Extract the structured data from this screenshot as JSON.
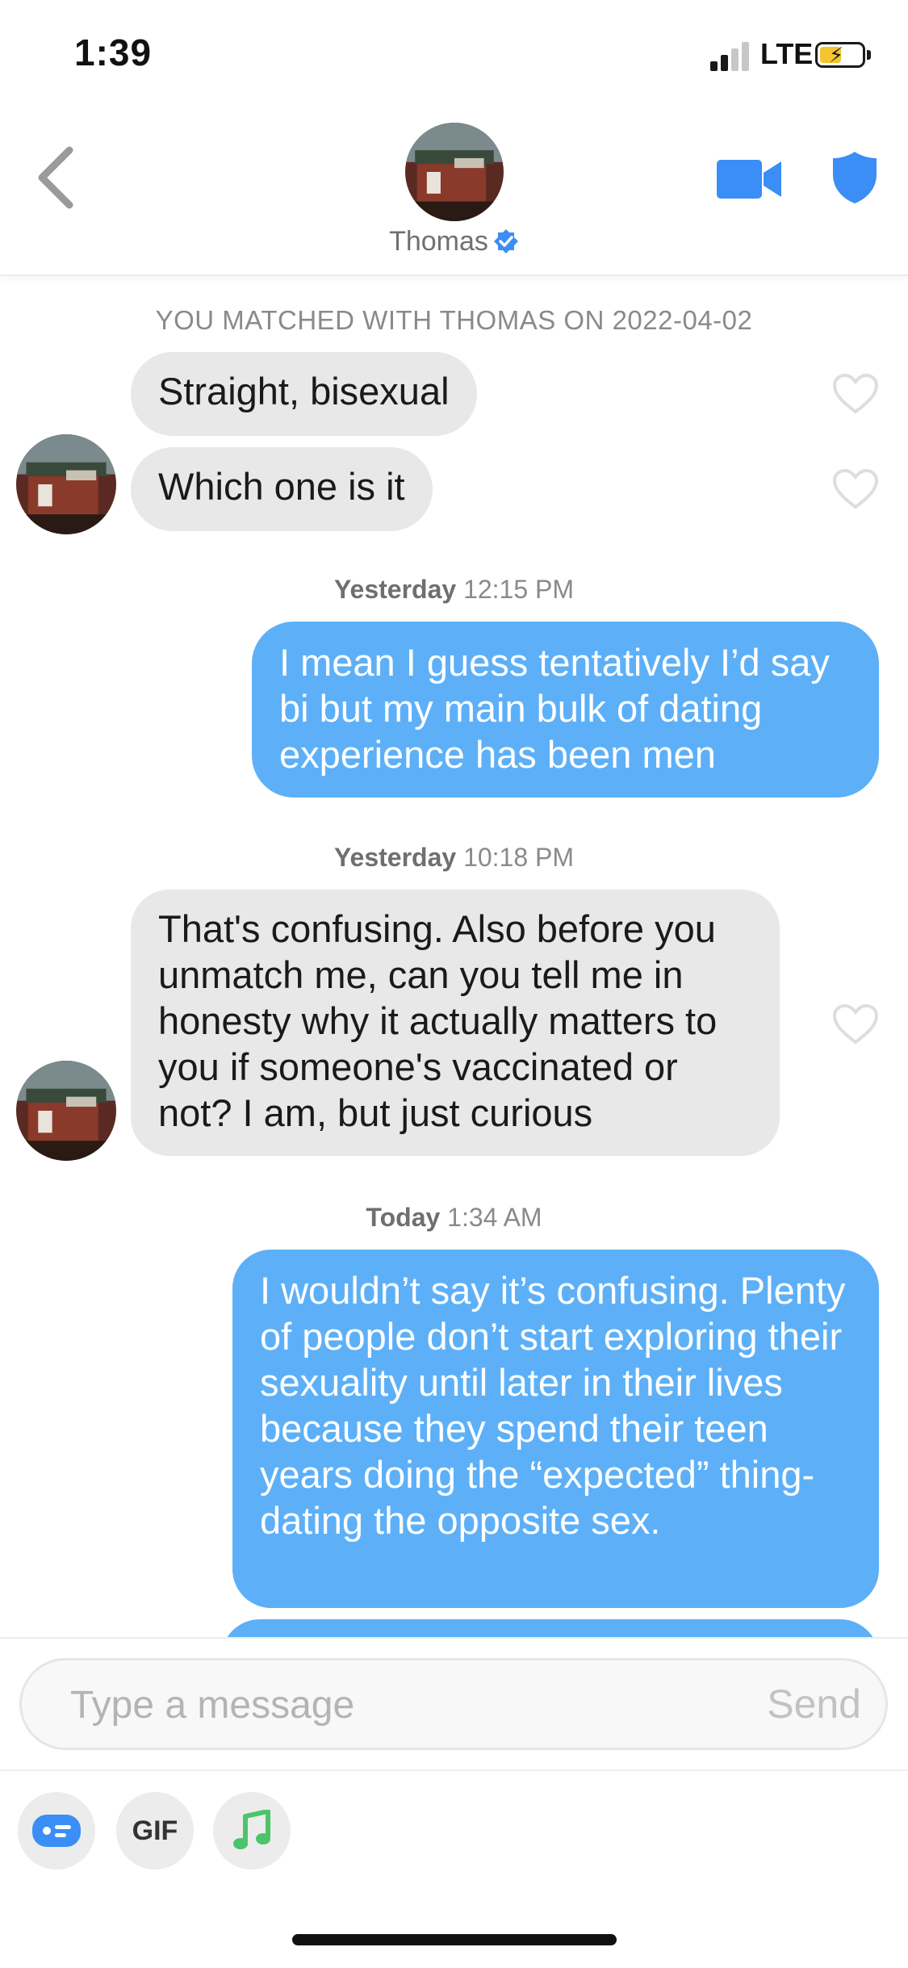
{
  "status_bar": {
    "time": "1:39",
    "network": "LTE"
  },
  "header": {
    "name": "Thomas"
  },
  "conversation": {
    "match_line": "YOU MATCHED WITH THOMAS ON 2022-04-02",
    "msg1": "Straight, bisexual",
    "msg2": "Which one is it",
    "ts1_day": "Yesterday",
    "ts1_time": "12:15 PM",
    "msg3": "I mean I guess tentatively I’d say bi but my main bulk of dating experience has been men",
    "ts2_day": "Yesterday",
    "ts2_time": "10:18 PM",
    "msg4": "That's confusing. Also before you unmatch me, can you tell me in honesty why it actually matters to you if someone's vaccinated or not? I am, but just curious",
    "ts3_day": "Today",
    "ts3_time": "1:34 AM",
    "msg5": "I wouldn’t say it’s confusing. Plenty of people don’t start exploring their sexuality until later in their lives because they spend their teen years doing the “expected” thing- dating the opposite sex."
  },
  "composer": {
    "placeholder": "Type a message",
    "send_label": "Send",
    "gif_label": "GIF"
  },
  "colors": {
    "outgoing_bubble": "#5db0f7",
    "incoming_bubble": "#e8e8e8",
    "accent_blue": "#3a8ef5",
    "music_green": "#4cc46a"
  },
  "icons": [
    "back-chevron-icon",
    "verified-badge-icon",
    "video-call-icon",
    "shield-icon",
    "heart-icon",
    "sticker-icon",
    "gif-icon",
    "music-note-icon"
  ]
}
